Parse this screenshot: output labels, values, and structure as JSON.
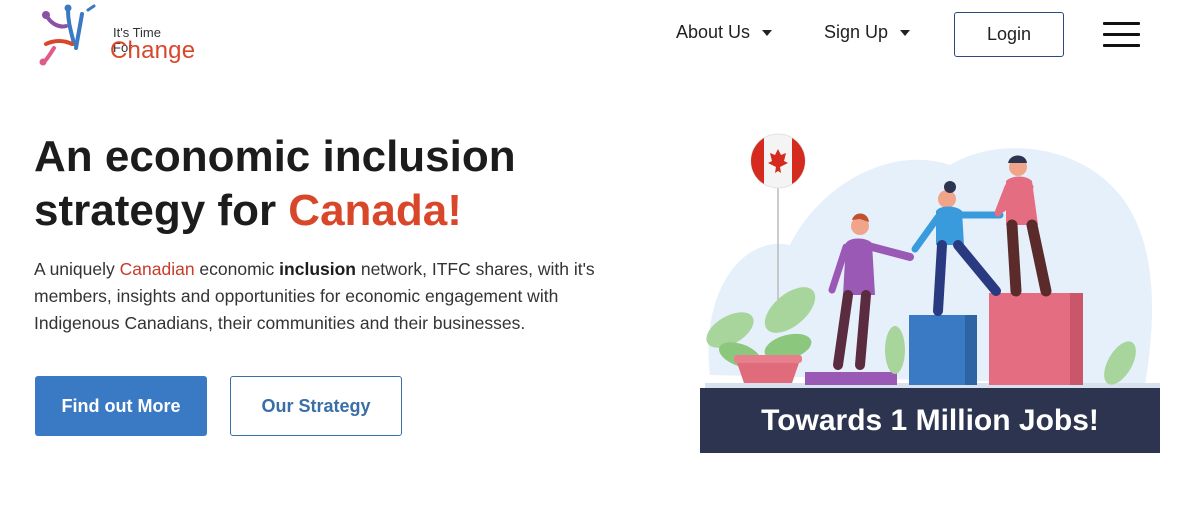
{
  "brand": {
    "tagline": "It's Time For",
    "name": "Change"
  },
  "nav": {
    "about": "About Us",
    "signup": "Sign Up",
    "login": "Login"
  },
  "hero": {
    "headline_line1": "An economic inclusion",
    "headline_line2_prefix": "strategy for ",
    "headline_accent": "Canada!",
    "desc_1": "A uniquely ",
    "desc_red": "Canadian",
    "desc_2": " economic ",
    "desc_bold": "inclusion",
    "desc_3": " network, ITFC shares, with it's members, insights and opportunities for economic engagement with Indigenous Canadians, their communities and their businesses.",
    "primary_button": "Find out More",
    "secondary_button": "Our Strategy"
  },
  "illustration": {
    "banner": "Towards 1 Million Jobs!",
    "icons": [
      "canada-flag-balloon-icon",
      "plant-icon",
      "people-helping-icon"
    ]
  },
  "colors": {
    "accent": "#d9472b",
    "primary": "#3a79c3",
    "banner": "#2d3450"
  }
}
